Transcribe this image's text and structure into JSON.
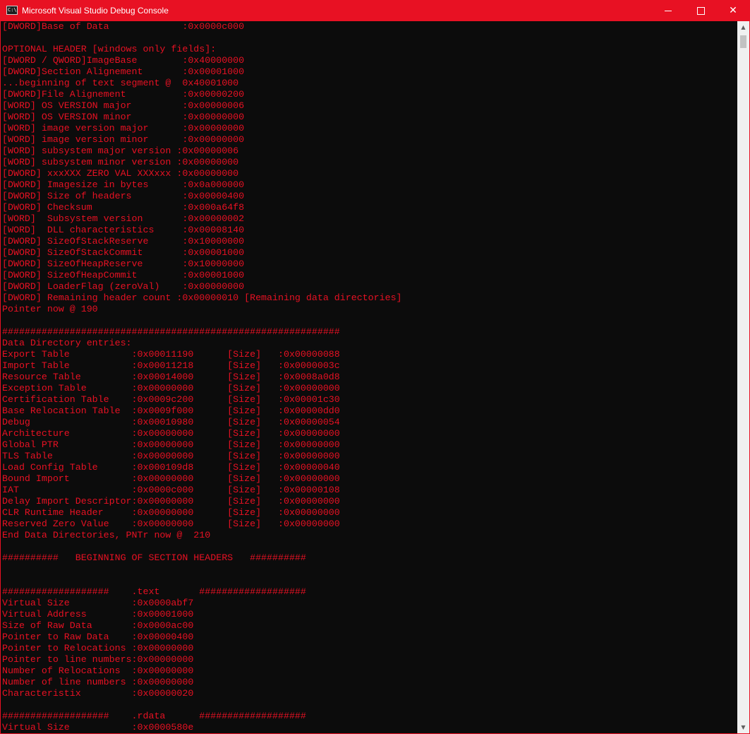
{
  "window": {
    "title": "Microsoft Visual Studio Debug Console",
    "icon": "console-app-icon",
    "icon_text": "C:\\",
    "accent": "#e81123",
    "text_color": "#e81123",
    "background": "#0c0c0c"
  },
  "controls": {
    "minimize": "minimize-icon",
    "maximize": "maximize-icon",
    "close": "✕"
  },
  "scrollbar": {
    "up_arrow": "▲",
    "down_arrow": "▼",
    "position": 0.0
  },
  "console": {
    "lines": [
      "[DWORD]Base of Data             :0x0000c000",
      "",
      "OPTIONAL HEADER [windows only fields]:",
      "[DWORD / QWORD]ImageBase        :0x40000000",
      "[DWORD]Section Alignement       :0x00001000",
      "...beginning of text segment @  0x40001000",
      "[DWORD]File Alignement          :0x00000200",
      "[WORD] OS VERSION major         :0x00000006",
      "[WORD] OS VERSION minor         :0x00000000",
      "[WORD] image version major      :0x00000000",
      "[WORD] image version minor      :0x00000000",
      "[WORD] subsystem major version :0x00000006",
      "[WORD] subsystem minor version :0x00000000",
      "[DWORD] xxxXXX ZERO VAL XXXxxx :0x00000000",
      "[DWORD] Imagesize in bytes      :0x0a000000",
      "[DWORD] Size of headers         :0x00000400",
      "[DWORD] Checksum                :0x000a64f8",
      "[WORD]  Subsystem version       :0x00000002",
      "[WORD]  DLL characteristics     :0x00008140",
      "[DWORD] SizeOfStackReserve      :0x10000000",
      "[DWORD] SizeOfStackCommit       :0x00001000",
      "[DWORD] SizeOfHeapReserve       :0x10000000",
      "[DWORD] SizeOfHeapCommit        :0x00001000",
      "[DWORD] LoaderFlag (zeroVal)    :0x00000000",
      "[DWORD] Remaining header count :0x00000010 [Remaining data directories]",
      "Pointer now @ 190",
      "",
      "############################################################",
      "Data Directory entries:",
      "Export Table           :0x00011190      [Size]   :0x00000088",
      "Import Table           :0x00011218      [Size]   :0x0000003c",
      "Resource Table         :0x00014000      [Size]   :0x0008a0d8",
      "Exception Table        :0x00000000      [Size]   :0x00000000",
      "Certification Table    :0x0009c200      [Size]   :0x00001c30",
      "Base Relocation Table  :0x0009f000      [Size]   :0x00000dd0",
      "Debug                  :0x00010980      [Size]   :0x00000054",
      "Architecture           :0x00000000      [Size]   :0x00000000",
      "Global PTR             :0x00000000      [Size]   :0x00000000",
      "TLS Table              :0x00000000      [Size]   :0x00000000",
      "Load Config Table      :0x000109d8      [Size]   :0x00000040",
      "Bound Import           :0x00000000      [Size]   :0x00000000",
      "IAT                    :0x0000c000      [Size]   :0x00000108",
      "Delay Import Descriptor:0x00000000      [Size]   :0x00000000",
      "CLR Runtime Header     :0x00000000      [Size]   :0x00000000",
      "Reserved Zero Value    :0x00000000      [Size]   :0x00000000",
      "End Data Directories, PNTr now @  210",
      "",
      "##########   BEGINNING OF SECTION HEADERS   ##########",
      "",
      "",
      "###################    .text       ###################",
      "Virtual Size           :0x0000abf7",
      "Virtual Address        :0x00001000",
      "Size of Raw Data       :0x0000ac00",
      "Pointer to Raw Data    :0x00000400",
      "Pointer to Relocations :0x00000000",
      "Pointer to line numbers:0x00000000",
      "Number of Relocations  :0x00000000",
      "Number of line numbers :0x00000000",
      "Characteristix         :0x00000020",
      "",
      "###################    .rdata      ###################",
      "Virtual Size           :0x0000580e"
    ]
  }
}
